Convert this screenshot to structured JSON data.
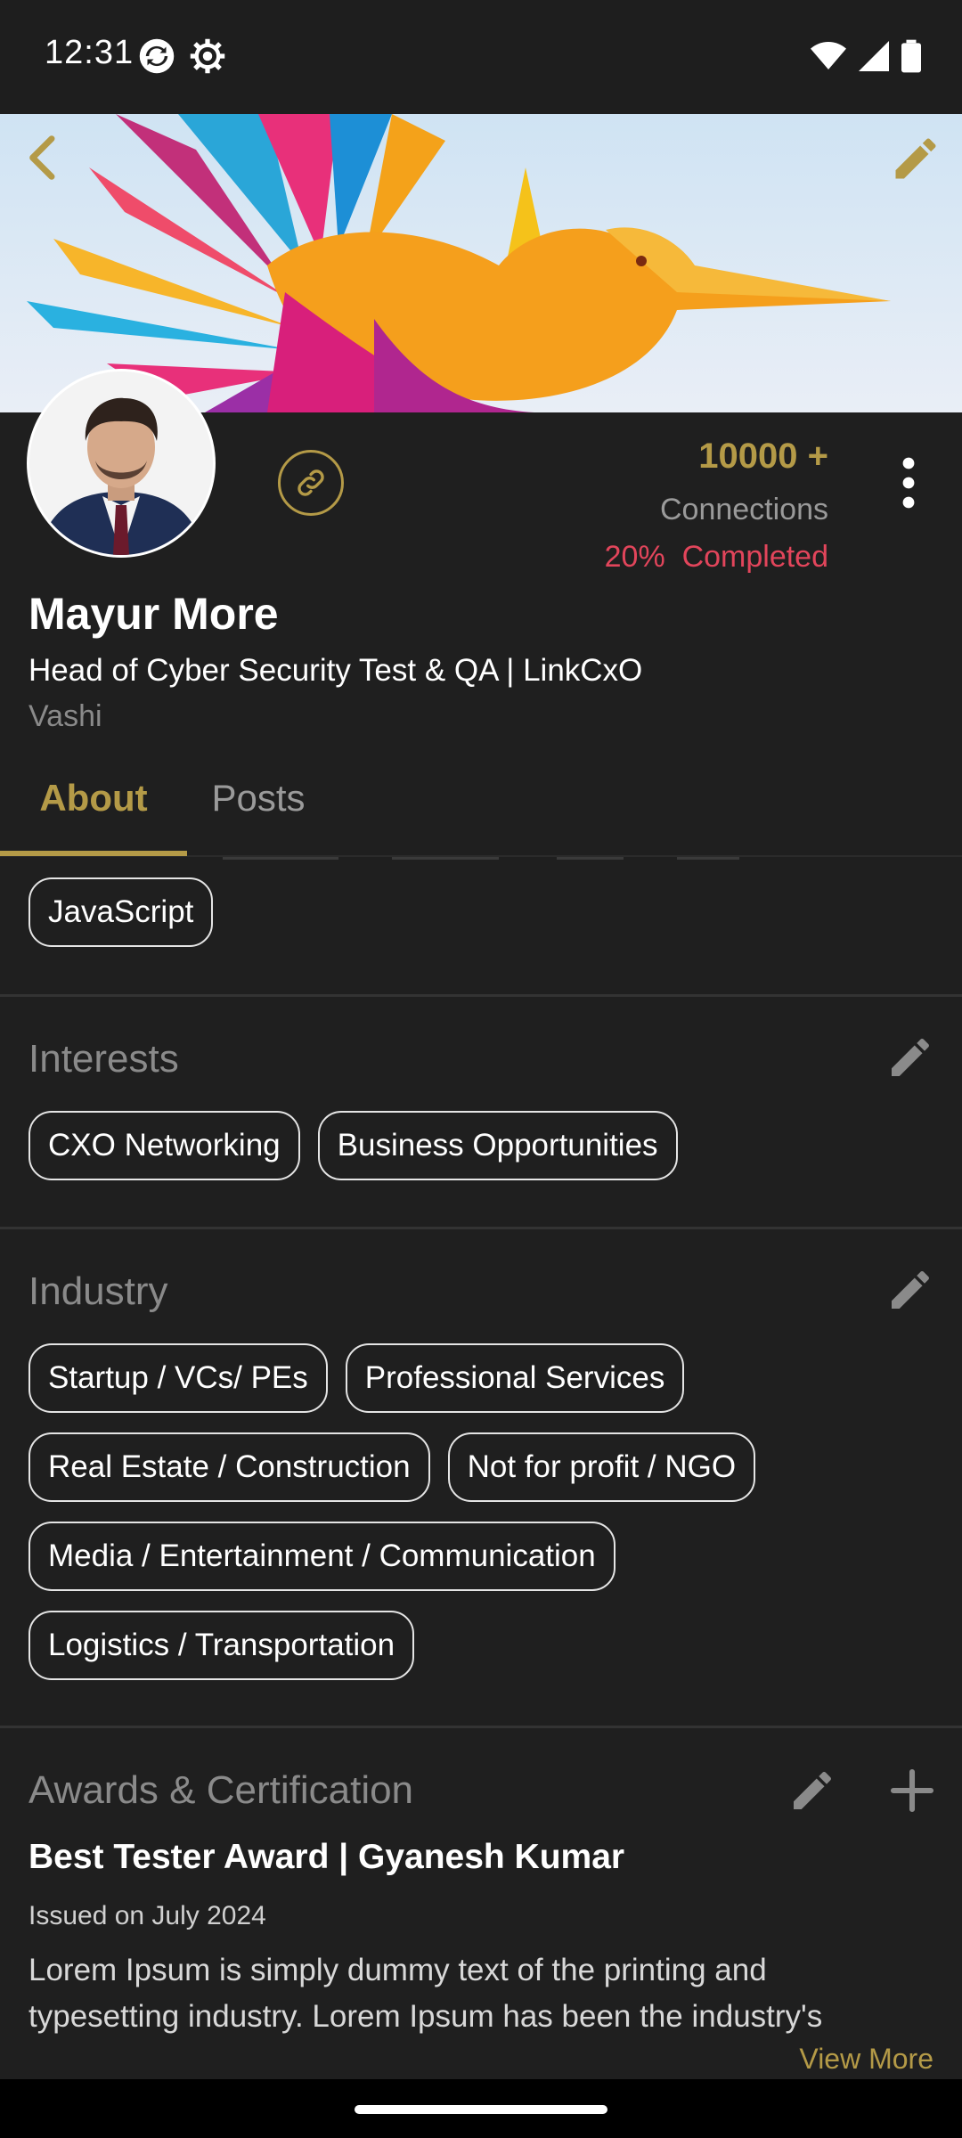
{
  "status_bar": {
    "time": "12:31"
  },
  "profile": {
    "connections_count": "10000 +",
    "connections_label": "Connections",
    "completion": "20%  Completed",
    "name": "Mayur More",
    "headline": "Head of Cyber Security Test & QA | LinkCxO",
    "location": "Vashi"
  },
  "tabs": [
    {
      "label": "About"
    },
    {
      "label": "Posts"
    }
  ],
  "skills": {
    "visible_chips": [
      "JavaScript"
    ]
  },
  "interests": {
    "title": "Interests",
    "chips": [
      "CXO Networking",
      "Business Opportunities"
    ]
  },
  "industry": {
    "title": "Industry",
    "chips": [
      "Startup / VCs/ PEs",
      "Professional Services",
      "Real Estate / Construction",
      "Not for profit / NGO",
      "Media / Entertainment / Communication",
      "Logistics / Transportation"
    ]
  },
  "awards": {
    "title": "Awards & Certification",
    "items": [
      {
        "title": "Best Tester Award | Gyanesh Kumar",
        "issued": "Issued on July 2024",
        "description": "Lorem Ipsum is simply dummy text of the printing and typesetting industry. Lorem Ipsum has been the industry's",
        "view_more": "View More"
      }
    ]
  },
  "colors": {
    "accent": "#b49a47",
    "completion": "#e2455b",
    "background": "#1f1f1f"
  },
  "icons": {
    "back": "chevron-left-icon",
    "edit": "pencil-icon",
    "link": "link-icon",
    "more": "more-vertical-icon",
    "add": "plus-icon"
  }
}
